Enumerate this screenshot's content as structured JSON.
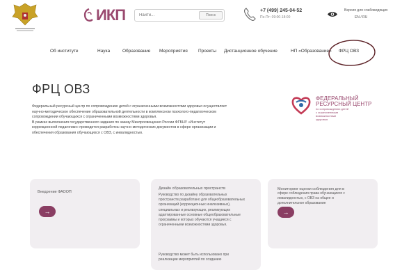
{
  "header": {
    "logo_text": "ИКП",
    "search": {
      "placeholder": "Найти...",
      "button_label": "Поиск"
    },
    "contacts": {
      "phone": "+7 (499) 245-04-52",
      "hours": "Пн-Пт: 09:00-18:00"
    },
    "accessibility": {
      "label": "Версия для слабовидящих",
      "lang": "EN / RU"
    }
  },
  "nav": {
    "items": [
      "Об институте",
      "Наука",
      "Образование",
      "Мероприятия",
      "Проекты",
      "Дистанционное обучение",
      "НП «Образование»",
      "ФРЦ ОВЗ"
    ]
  },
  "main": {
    "title": "ФРЦ ОВЗ",
    "description": [
      "Федеральный ресурсный центр по сопровождению детей с ограниченными возможностями здоровья осуществляет",
      "научно-методическое обеспечение образовательной деятельности в комплексном психолого-педагогическом",
      "сопровождении обучающихся с ограниченными возможностями здоровья.",
      "В рамках выполнения государственного задания по заказу Минпросвещения России ФГБНУ «Институт",
      "коррекционной педагогики» проводится разработка научно-методических документов в сфере организации и",
      "обеспечения образования обучающихся с ОВЗ, с инвалидностью."
    ],
    "frc_logo": {
      "line1": "ФЕДЕРАЛЬНЫЙ",
      "line2": "РЕСУРСНЫЙ ЦЕНТР",
      "small": [
        "по сопровождению детей",
        "с ограниченными",
        "возможностями",
        "здоровья"
      ]
    }
  },
  "cards": [
    {
      "title": "Внедрение ФАООП",
      "lines": [],
      "arrow": "→"
    },
    {
      "title": "Дизайн образовательных пространств",
      "lines": [
        "Руководство по дизайну образовательных",
        "пространств разработано для общеобразовательных",
        "организаций (коррекционных инклюзивных),",
        "специальных и реализующих, реализующих",
        "адаптированные основные общеобразовательные",
        "программы и которых обучаются учащиеся с",
        "ограниченными возможностями здоровья."
      ],
      "lines2": [
        "Руководство может быть использовано при",
        "реализации мероприятий по созданию"
      ],
      "arrow": ""
    },
    {
      "title": "Мониторинг оценки соблюдения для в",
      "lines": [
        "сфере соблюдения права обучающихся с",
        "инвалидностью, с ОВЗ на общее и",
        "дополнительное образование"
      ],
      "arrow": "→"
    }
  ],
  "colors": {
    "brand": "#8a3e63",
    "card_bg": "#f1eef1",
    "annotation": "#5a1f24"
  }
}
